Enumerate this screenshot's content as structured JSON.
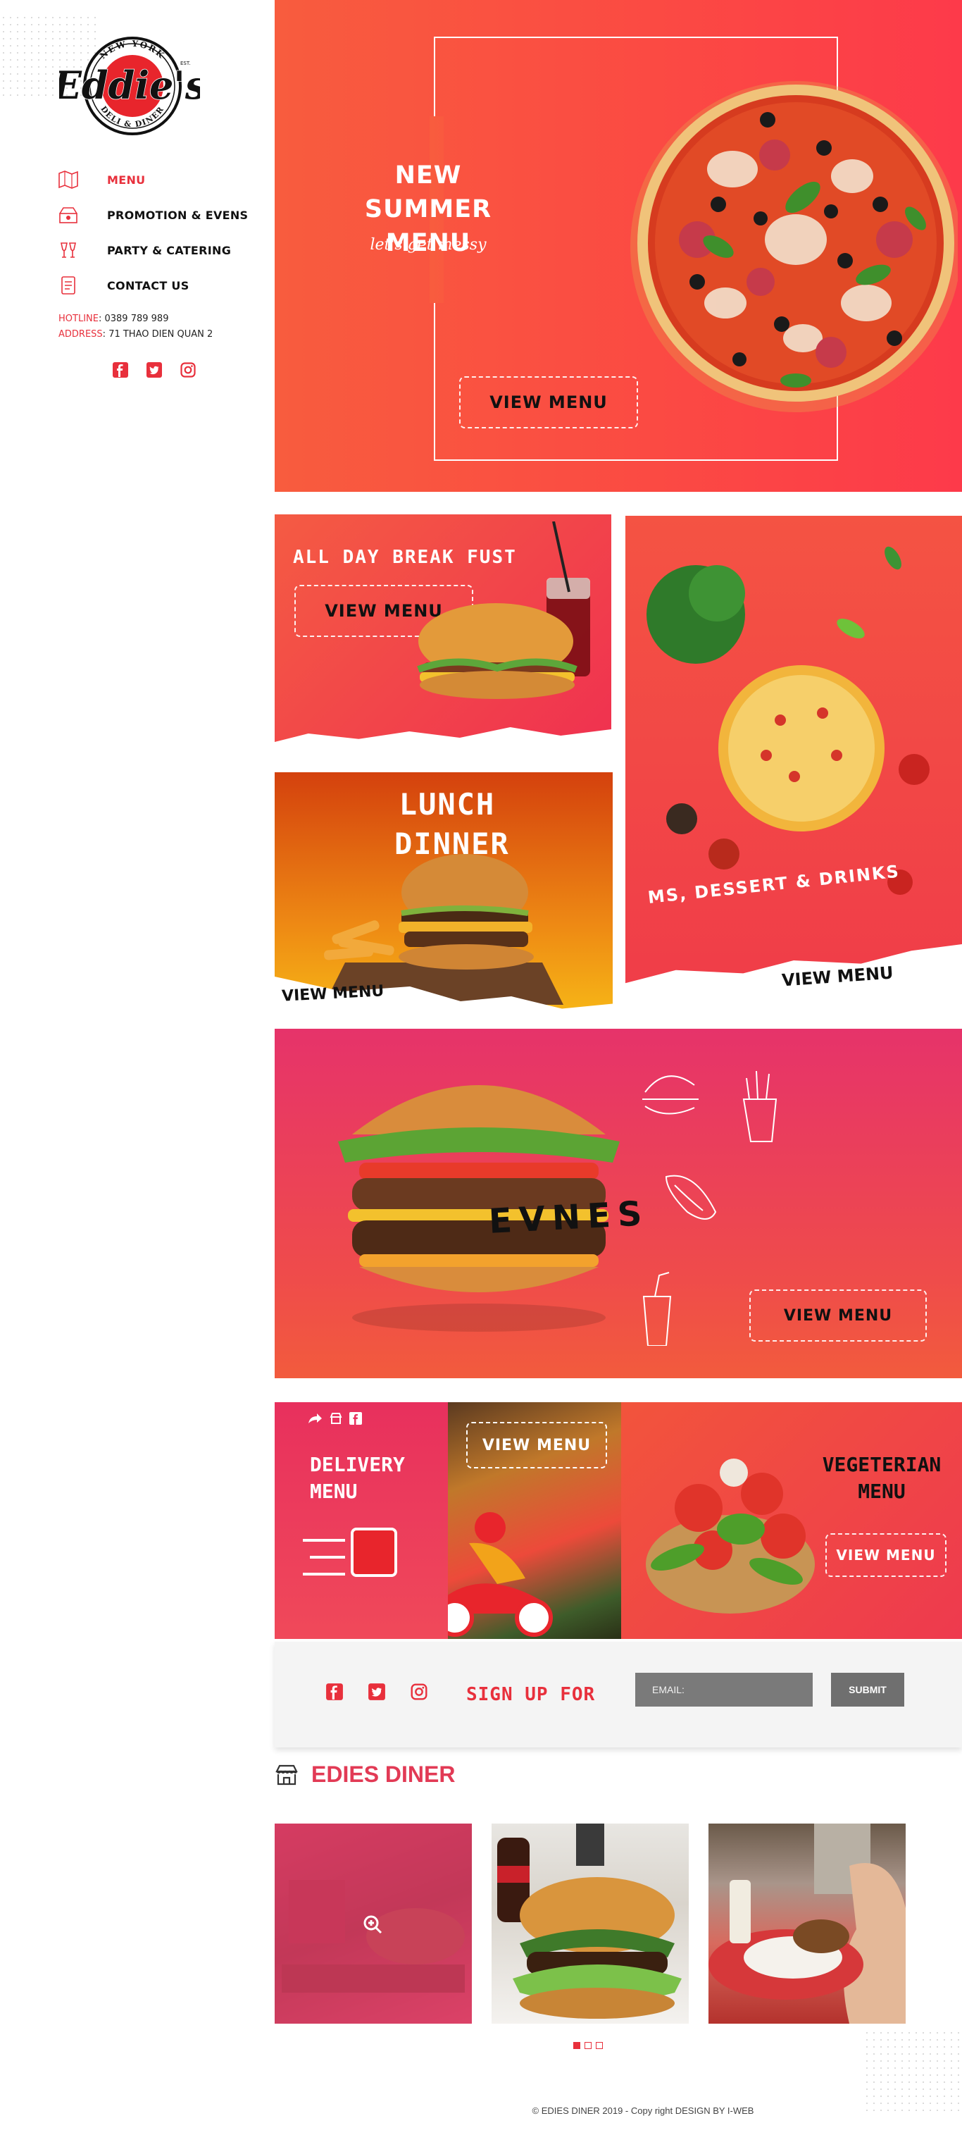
{
  "sidebar": {
    "logo": {
      "top_arc": "NEW YORK",
      "wordmark": "Eddie's",
      "bottom_arc": "DELI & DINER",
      "est": "EST."
    },
    "nav": [
      {
        "label": "MENU",
        "icon": "menu-icon",
        "active": true
      },
      {
        "label": "PROMOTION & EVENS",
        "icon": "promotion-icon",
        "active": false
      },
      {
        "label": "PARTY & CATERING",
        "icon": "party-icon",
        "active": false
      },
      {
        "label": "CONTACT US",
        "icon": "contact-icon",
        "active": false
      }
    ],
    "hotline_label": "HOTLINE",
    "hotline": "0389 789 989",
    "address_label": "ADDRESS",
    "address": "71 THAO DIEN QUAN 2",
    "social": [
      "facebook-icon",
      "twitter-icon",
      "instagram-icon"
    ]
  },
  "hero": {
    "title_line1": "NEW SUMMER",
    "title_line2": "MENU",
    "subtitle": "let's get messy",
    "button": "VIEW MENU"
  },
  "breakfast": {
    "title": "ALL DAY BREAK FUST",
    "button": "VIEW MENU"
  },
  "lunch": {
    "title_line1": "LUNCH",
    "title_line2": "DINNER",
    "button": "VIEW MENU"
  },
  "dessert": {
    "title": "MS, DESSERT  &  DRINKS",
    "button": "VIEW MENU"
  },
  "evnes": {
    "title": "EVNES",
    "button": "VIEW MENU"
  },
  "delivery": {
    "title_line1": "DELIVERY",
    "title_line2": "MENU",
    "button": "VIEW MENU"
  },
  "vegetarian": {
    "title_line1": "VEGETERIAN",
    "title_line2": "MENU",
    "button": "VIEW MENU"
  },
  "signup": {
    "label": "SIGN UP FOR",
    "email_placeholder": "EMAIL:",
    "submit": "SUBMIT"
  },
  "gallery": {
    "title": "EDIES DINER"
  },
  "footer": {
    "text": "© EDIES DINER 2019 - Copy right DESIGN BY I-WEB"
  },
  "colors": {
    "brand_red": "#e8303c",
    "gallery_pink": "#e23a55"
  }
}
